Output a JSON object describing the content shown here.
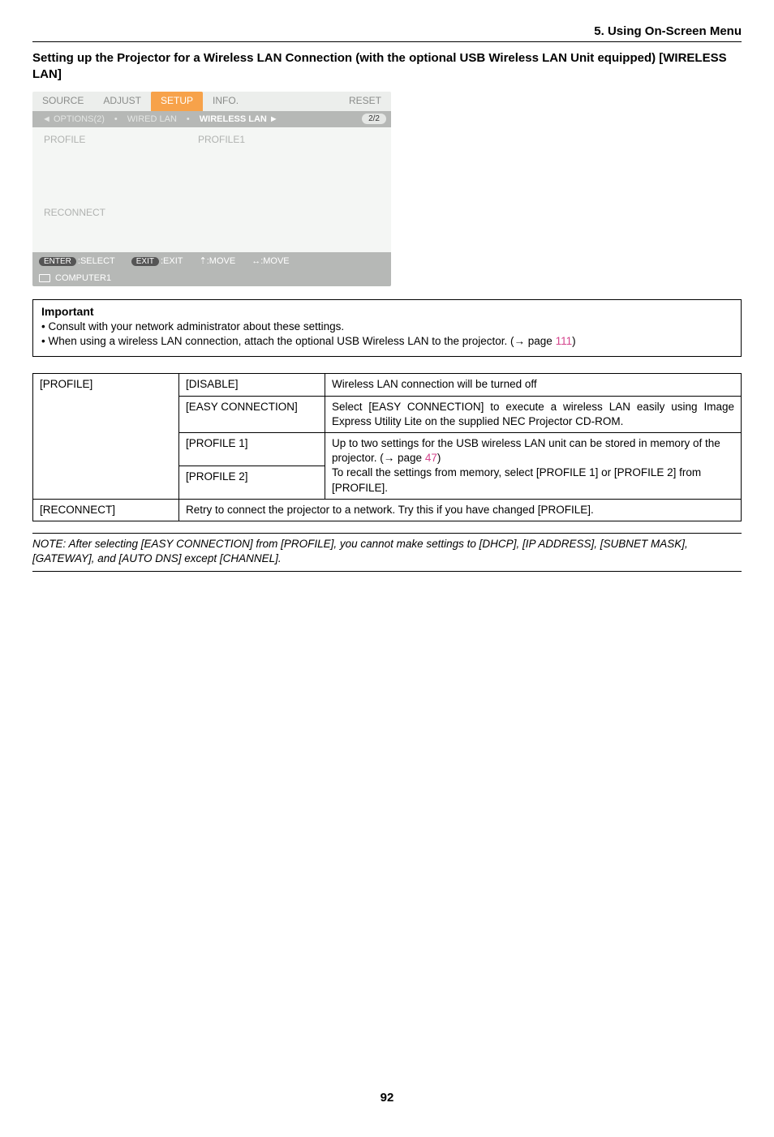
{
  "header": {
    "title": "5. Using On-Screen Menu"
  },
  "subsection": {
    "title": "Setting up the Projector for a Wireless LAN Connection (with the optional USB Wireless LAN Unit equipped) [WIRELESS LAN]"
  },
  "screenshot": {
    "tabs": {
      "source": "SOURCE",
      "adjust": "ADJUST",
      "setup": "SETUP",
      "info": "INFO.",
      "reset": "RESET"
    },
    "subtabs": {
      "left": "◄ OPTIONS(2)",
      "mid": "WIRED LAN",
      "active": "WIRELESS LAN ►",
      "count": "2/2"
    },
    "rows": {
      "profile_label": "PROFILE",
      "profile_value": "PROFILE1",
      "reconnect": "RECONNECT"
    },
    "footer": {
      "enter_pill": "ENTER",
      "enter": ":SELECT",
      "exit_pill": "EXIT",
      "exit": ":EXIT",
      "move1": "⇡:MOVE",
      "move2": "↔:MOVE"
    },
    "bottom": "COMPUTER1"
  },
  "important": {
    "title": "Important",
    "item1": "Consult with your network administrator about these settings.",
    "item2a": "When using a wireless LAN connection, attach the optional USB Wireless LAN to the projector. (→ page ",
    "item2_link": "111",
    "item2b": ")"
  },
  "table": {
    "r1c1": "[PROFILE]",
    "r1c2": "[DISABLE]",
    "r1c3": "Wireless LAN connection will be turned off",
    "r2c2": "[EASY CONNECTION]",
    "r2c3": "Select [EASY CONNECTION] to execute a wireless LAN easily using Image Express Utility Lite on the supplied NEC Projector CD-ROM.",
    "r3c2": "[PROFILE 1]",
    "r3c3a": "Up to two settings for the USB wireless LAN unit can be stored in memory of the projector. (→ page ",
    "r3c3_link": "47",
    "r3c3b": ")\nTo recall the settings from memory, select [PROFILE 1] or [PROFILE 2] from [PROFILE].",
    "r4c2": "[PROFILE 2]",
    "r5c1": "[RECONNECT]",
    "r5c2": "Retry to connect the projector to a network. Try this if you have changed [PROFILE]."
  },
  "note": "NOTE: After selecting [EASY CONNECTION] from [PROFILE], you cannot make settings to [DHCP], [IP ADDRESS], [SUBNET MASK], [GATEWAY], and [AUTO DNS] except [CHANNEL].",
  "page_number": "92"
}
